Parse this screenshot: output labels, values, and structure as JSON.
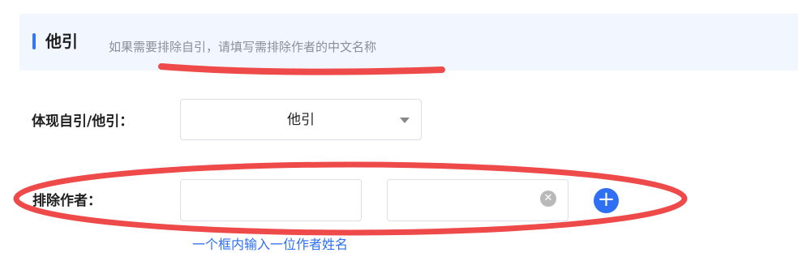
{
  "section": {
    "title": "他引",
    "hint": "如果需要排除自引，请填写需排除作者的中文名称"
  },
  "citation_type": {
    "label": "体现自引/他引：",
    "value": "他引"
  },
  "exclude_author": {
    "label": "排除作者：",
    "field1_value": "",
    "field2_value": "",
    "helper": "一个框内输入一位作者姓名"
  },
  "annotation_color": "#ef4a4a",
  "accent_color": "#3576f6"
}
